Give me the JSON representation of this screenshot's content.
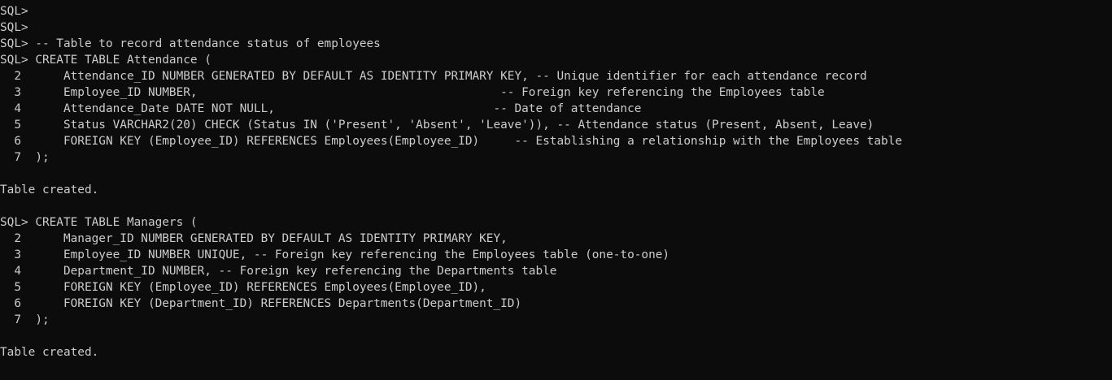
{
  "terminal": {
    "lines": [
      "SQL>",
      "SQL>",
      "SQL> -- Table to record attendance status of employees",
      "SQL> CREATE TABLE Attendance (",
      "  2      Attendance_ID NUMBER GENERATED BY DEFAULT AS IDENTITY PRIMARY KEY, -- Unique identifier for each attendance record",
      "  3      Employee_ID NUMBER,                                           -- Foreign key referencing the Employees table",
      "  4      Attendance_Date DATE NOT NULL,                               -- Date of attendance",
      "  5      Status VARCHAR2(20) CHECK (Status IN ('Present', 'Absent', 'Leave')), -- Attendance status (Present, Absent, Leave)",
      "  6      FOREIGN KEY (Employee_ID) REFERENCES Employees(Employee_ID)     -- Establishing a relationship with the Employees table",
      "  7  );",
      "",
      "Table created.",
      "",
      "SQL> CREATE TABLE Managers (",
      "  2      Manager_ID NUMBER GENERATED BY DEFAULT AS IDENTITY PRIMARY KEY,",
      "  3      Employee_ID NUMBER UNIQUE, -- Foreign key referencing the Employees table (one-to-one)",
      "  4      Department_ID NUMBER, -- Foreign key referencing the Departments table",
      "  5      FOREIGN KEY (Employee_ID) REFERENCES Employees(Employee_ID),",
      "  6      FOREIGN KEY (Department_ID) REFERENCES Departments(Department_ID)",
      "  7  );",
      "",
      "Table created.",
      ""
    ]
  },
  "colors": {
    "background": "#0c0c0c",
    "text": "#cccccc"
  }
}
